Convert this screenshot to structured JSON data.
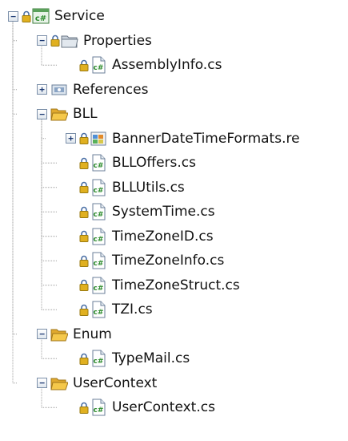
{
  "tree": [
    {
      "label": "Service",
      "icon": "csharp-project-icon",
      "lock": true,
      "expander": "minus",
      "depth": 0
    },
    {
      "label": "Properties",
      "icon": "properties-folder-icon",
      "lock": true,
      "expander": "minus",
      "depth": 1
    },
    {
      "label": "AssemblyInfo.cs",
      "icon": "csharp-file-icon",
      "lock": true,
      "expander": "none",
      "depth": 2
    },
    {
      "label": "References",
      "icon": "references-icon",
      "lock": false,
      "expander": "plus",
      "depth": 1
    },
    {
      "label": "BLL",
      "icon": "folder-open-icon",
      "lock": false,
      "expander": "minus",
      "depth": 1
    },
    {
      "label": "BannerDateTimeFormats.re",
      "icon": "resource-file-icon",
      "lock": true,
      "expander": "plus",
      "depth": 2
    },
    {
      "label": "BLLOffers.cs",
      "icon": "csharp-file-icon",
      "lock": true,
      "expander": "none",
      "depth": 2
    },
    {
      "label": "BLLUtils.cs",
      "icon": "csharp-file-icon",
      "lock": true,
      "expander": "none",
      "depth": 2
    },
    {
      "label": "SystemTime.cs",
      "icon": "csharp-file-icon",
      "lock": true,
      "expander": "none",
      "depth": 2
    },
    {
      "label": "TimeZoneID.cs",
      "icon": "csharp-file-icon",
      "lock": true,
      "expander": "none",
      "depth": 2
    },
    {
      "label": "TimeZoneInfo.cs",
      "icon": "csharp-file-icon",
      "lock": true,
      "expander": "none",
      "depth": 2
    },
    {
      "label": "TimeZoneStruct.cs",
      "icon": "csharp-file-icon",
      "lock": true,
      "expander": "none",
      "depth": 2
    },
    {
      "label": "TZI.cs",
      "icon": "csharp-file-icon",
      "lock": true,
      "expander": "none",
      "depth": 2
    },
    {
      "label": "Enum",
      "icon": "folder-open-icon",
      "lock": false,
      "expander": "minus",
      "depth": 1
    },
    {
      "label": "TypeMail.cs",
      "icon": "csharp-file-icon",
      "lock": true,
      "expander": "none",
      "depth": 2
    },
    {
      "label": "UserContext",
      "icon": "folder-open-icon",
      "lock": false,
      "expander": "minus",
      "depth": 1
    },
    {
      "label": "UserContext.cs",
      "icon": "csharp-file-icon",
      "lock": true,
      "expander": "none",
      "depth": 2
    }
  ],
  "colors": {
    "line": "#a0a0a0",
    "folder": "#f5c84a",
    "lock": "#e0b020",
    "csharp": "#2a8a2a"
  }
}
